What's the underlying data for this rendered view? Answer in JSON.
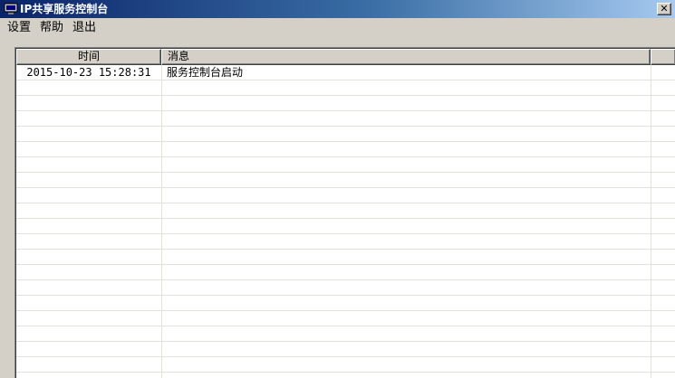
{
  "window": {
    "title": "IP共享服务控制台",
    "close_glyph": "✕"
  },
  "menu": {
    "items": [
      "设置",
      "帮助",
      "退出"
    ]
  },
  "log": {
    "columns": [
      "时间",
      "消息"
    ],
    "rows": [
      {
        "time": "2015-10-23 15:28:31",
        "message": "服务控制台启动"
      }
    ]
  },
  "colors": {
    "titlebar_start": "#0a246a",
    "window_face": "#d4d0c8",
    "grid_line": "#e2e2dc"
  }
}
